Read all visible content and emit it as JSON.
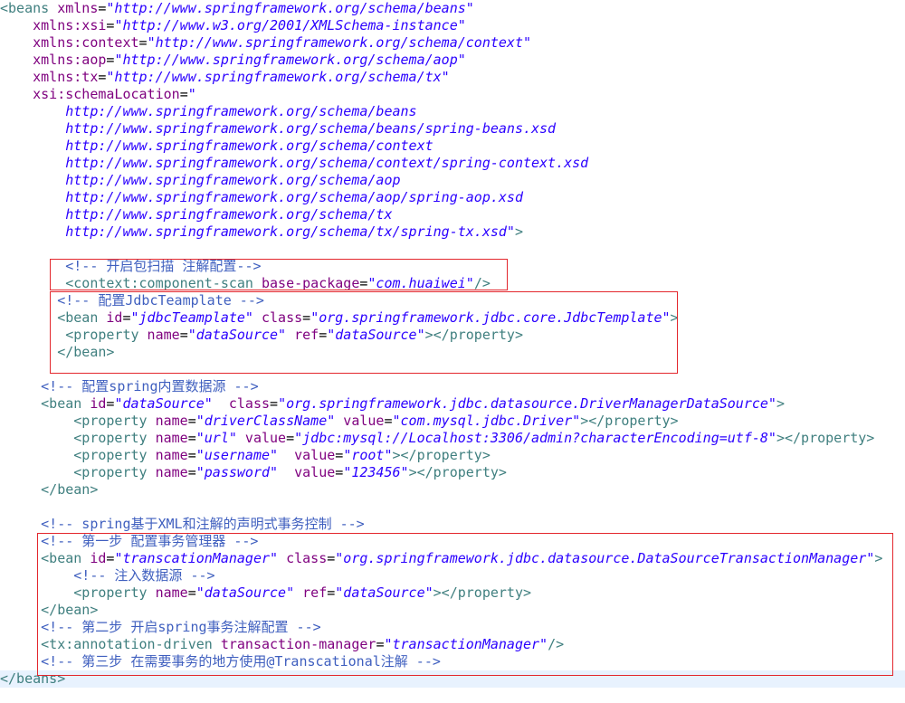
{
  "editor": {
    "highlighted_line": 39,
    "lines": [
      [
        {
          "t": "<beans",
          "c": "tag"
        },
        {
          "t": " xmlns",
          "c": "attr"
        },
        {
          "t": "=",
          "c": "punct"
        },
        {
          "t": "\"http://www.springframework.org/schema/beans\"",
          "c": "val"
        }
      ],
      [
        {
          "t": "    xmlns:xsi",
          "c": "attr"
        },
        {
          "t": "=",
          "c": "punct"
        },
        {
          "t": "\"http://www.w3.org/2001/XMLSchema-instance\"",
          "c": "val"
        }
      ],
      [
        {
          "t": "    xmlns:context",
          "c": "attr"
        },
        {
          "t": "=",
          "c": "punct"
        },
        {
          "t": "\"http://www.springframework.org/schema/context\"",
          "c": "val"
        }
      ],
      [
        {
          "t": "    xmlns:aop",
          "c": "attr"
        },
        {
          "t": "=",
          "c": "punct"
        },
        {
          "t": "\"http://www.springframework.org/schema/aop\"",
          "c": "val"
        }
      ],
      [
        {
          "t": "    xmlns:tx",
          "c": "attr"
        },
        {
          "t": "=",
          "c": "punct"
        },
        {
          "t": "\"http://www.springframework.org/schema/tx\"",
          "c": "val"
        }
      ],
      [
        {
          "t": "    xsi:schemaLocation",
          "c": "attr"
        },
        {
          "t": "=",
          "c": "punct"
        },
        {
          "t": "\"",
          "c": "val"
        }
      ],
      [
        {
          "t": "        http://www.springframework.org/schema/beans",
          "c": "val"
        }
      ],
      [
        {
          "t": "        http://www.springframework.org/schema/beans/spring-beans.xsd",
          "c": "val"
        }
      ],
      [
        {
          "t": "        http://www.springframework.org/schema/context",
          "c": "val"
        }
      ],
      [
        {
          "t": "        http://www.springframework.org/schema/context/spring-context.xsd",
          "c": "val"
        }
      ],
      [
        {
          "t": "        http://www.springframework.org/schema/aop",
          "c": "val"
        }
      ],
      [
        {
          "t": "        http://www.springframework.org/schema/aop/spring-aop.xsd",
          "c": "val"
        }
      ],
      [
        {
          "t": "        http://www.springframework.org/schema/tx",
          "c": "val"
        }
      ],
      [
        {
          "t": "        http://www.springframework.org/schema/tx/spring-tx.xsd\"",
          "c": "val"
        },
        {
          "t": ">",
          "c": "tag"
        }
      ],
      [],
      [
        {
          "t": "        <!-- 开启包扫描 注解配置-->",
          "c": "cmt"
        }
      ],
      [
        {
          "t": "        <context:component-scan",
          "c": "tag"
        },
        {
          "t": " base-package",
          "c": "attr"
        },
        {
          "t": "=",
          "c": "punct"
        },
        {
          "t": "\"com.huaiwei\"",
          "c": "val"
        },
        {
          "t": "/>",
          "c": "tag"
        }
      ],
      [
        {
          "t": "       <!-- 配置JdbcTeamplate -->",
          "c": "cmt"
        }
      ],
      [
        {
          "t": "       <bean",
          "c": "tag"
        },
        {
          "t": " id",
          "c": "attr"
        },
        {
          "t": "=",
          "c": "punct"
        },
        {
          "t": "\"jdbcTeamplate\"",
          "c": "val"
        },
        {
          "t": " class",
          "c": "attr"
        },
        {
          "t": "=",
          "c": "punct"
        },
        {
          "t": "\"org.springframework.jdbc.core.JdbcTemplate\"",
          "c": "val"
        },
        {
          "t": ">",
          "c": "tag"
        }
      ],
      [
        {
          "t": "        <property",
          "c": "tag"
        },
        {
          "t": " name",
          "c": "attr"
        },
        {
          "t": "=",
          "c": "punct"
        },
        {
          "t": "\"dataSource\"",
          "c": "val"
        },
        {
          "t": " ref",
          "c": "attr"
        },
        {
          "t": "=",
          "c": "punct"
        },
        {
          "t": "\"dataSource\"",
          "c": "val"
        },
        {
          "t": "></property>",
          "c": "tag"
        }
      ],
      [
        {
          "t": "       </bean>",
          "c": "tag"
        }
      ],
      [],
      [
        {
          "t": "     <!-- 配置spring内置数据源 -->",
          "c": "cmt"
        }
      ],
      [
        {
          "t": "     <bean",
          "c": "tag"
        },
        {
          "t": " id",
          "c": "attr"
        },
        {
          "t": "=",
          "c": "punct"
        },
        {
          "t": "\"dataSource\"",
          "c": "val"
        },
        {
          "t": "  class",
          "c": "attr"
        },
        {
          "t": "=",
          "c": "punct"
        },
        {
          "t": "\"org.springframework.jdbc.datasource.DriverManagerDataSource\"",
          "c": "val"
        },
        {
          "t": ">",
          "c": "tag"
        }
      ],
      [
        {
          "t": "         <property",
          "c": "tag"
        },
        {
          "t": " name",
          "c": "attr"
        },
        {
          "t": "=",
          "c": "punct"
        },
        {
          "t": "\"driverClassName\"",
          "c": "val"
        },
        {
          "t": " value",
          "c": "attr"
        },
        {
          "t": "=",
          "c": "punct"
        },
        {
          "t": "\"com.mysql.jdbc.Driver\"",
          "c": "val"
        },
        {
          "t": "></property>",
          "c": "tag"
        }
      ],
      [
        {
          "t": "         <property",
          "c": "tag"
        },
        {
          "t": " name",
          "c": "attr"
        },
        {
          "t": "=",
          "c": "punct"
        },
        {
          "t": "\"url\"",
          "c": "val"
        },
        {
          "t": " value",
          "c": "attr"
        },
        {
          "t": "=",
          "c": "punct"
        },
        {
          "t": "\"jdbc:mysql://Localhost:3306/admin?characterEncoding=utf-8\"",
          "c": "val"
        },
        {
          "t": "></property>",
          "c": "tag"
        }
      ],
      [
        {
          "t": "         <property",
          "c": "tag"
        },
        {
          "t": " name",
          "c": "attr"
        },
        {
          "t": "=",
          "c": "punct"
        },
        {
          "t": "\"username\"",
          "c": "val"
        },
        {
          "t": "  value",
          "c": "attr"
        },
        {
          "t": "=",
          "c": "punct"
        },
        {
          "t": "\"root\"",
          "c": "val"
        },
        {
          "t": "></property>",
          "c": "tag"
        }
      ],
      [
        {
          "t": "         <property",
          "c": "tag"
        },
        {
          "t": " name",
          "c": "attr"
        },
        {
          "t": "=",
          "c": "punct"
        },
        {
          "t": "\"password\"",
          "c": "val"
        },
        {
          "t": "  value",
          "c": "attr"
        },
        {
          "t": "=",
          "c": "punct"
        },
        {
          "t": "\"123456\"",
          "c": "val"
        },
        {
          "t": "></property>",
          "c": "tag"
        }
      ],
      [
        {
          "t": "     </bean>",
          "c": "tag"
        }
      ],
      [],
      [
        {
          "t": "     <!-- spring基于XML和注解的声明式事务控制 -->",
          "c": "cmt"
        }
      ],
      [
        {
          "t": "     <!-- 第一步 配置事务管理器 -->",
          "c": "cmt"
        }
      ],
      [
        {
          "t": "     <bean",
          "c": "tag"
        },
        {
          "t": " id",
          "c": "attr"
        },
        {
          "t": "=",
          "c": "punct"
        },
        {
          "t": "\"transcationManager\"",
          "c": "val"
        },
        {
          "t": " class",
          "c": "attr"
        },
        {
          "t": "=",
          "c": "punct"
        },
        {
          "t": "\"org.springframework.jdbc.datasource.DataSourceTransactionManager\"",
          "c": "val"
        },
        {
          "t": ">",
          "c": "tag"
        }
      ],
      [
        {
          "t": "         <!-- 注入数据源 -->",
          "c": "cmt"
        }
      ],
      [
        {
          "t": "         <property",
          "c": "tag"
        },
        {
          "t": " name",
          "c": "attr"
        },
        {
          "t": "=",
          "c": "punct"
        },
        {
          "t": "\"dataSource\"",
          "c": "val"
        },
        {
          "t": " ref",
          "c": "attr"
        },
        {
          "t": "=",
          "c": "punct"
        },
        {
          "t": "\"dataSource\"",
          "c": "val"
        },
        {
          "t": "></property>",
          "c": "tag"
        }
      ],
      [
        {
          "t": "     </bean>",
          "c": "tag"
        }
      ],
      [
        {
          "t": "     <!-- 第二步 开启spring事务注解配置 -->",
          "c": "cmt"
        }
      ],
      [
        {
          "t": "     <tx:annotation-driven",
          "c": "tag"
        },
        {
          "t": " transaction-manager",
          "c": "attr"
        },
        {
          "t": "=",
          "c": "punct"
        },
        {
          "t": "\"transactionManager\"",
          "c": "val"
        },
        {
          "t": "/>",
          "c": "tag"
        }
      ],
      [
        {
          "t": "     <!-- 第三步 在需要事务的地方使用@Transcational注解 -->",
          "c": "cmt"
        }
      ],
      [
        {
          "t": "</beans>",
          "c": "tag"
        }
      ]
    ]
  }
}
